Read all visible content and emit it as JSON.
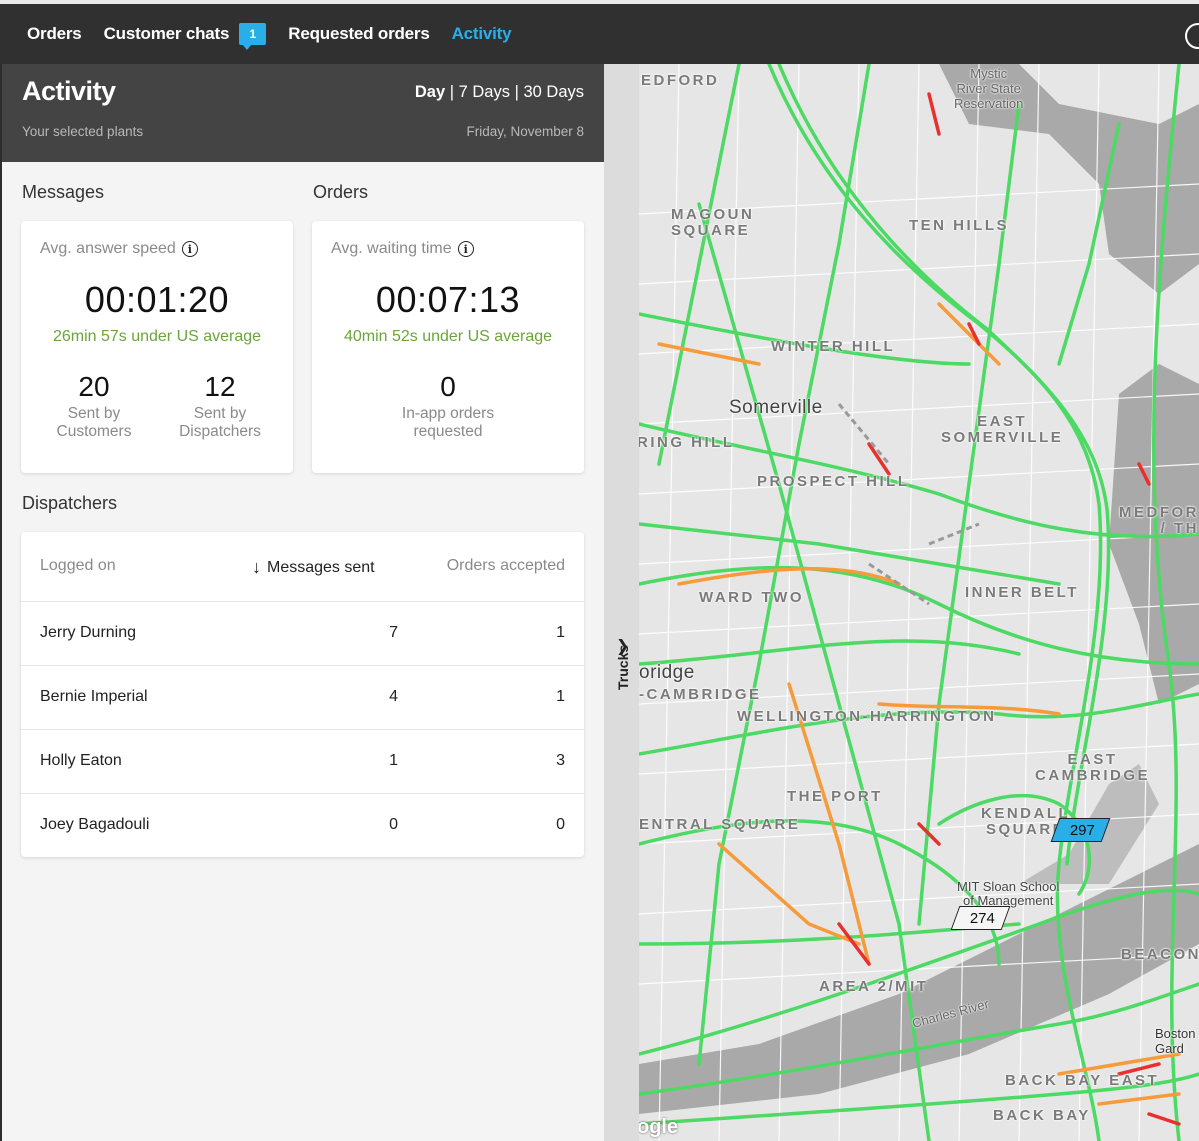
{
  "nav": {
    "items": [
      {
        "label": "Orders"
      },
      {
        "label": "Customer chats",
        "badge": "1"
      },
      {
        "label": "Requested orders"
      },
      {
        "label": "Activity"
      }
    ],
    "active_index": 3,
    "accent": "#2aaee8"
  },
  "activity": {
    "title": "Activity",
    "subtitle": "Your selected plants",
    "ranges": [
      "Day",
      "7 Days",
      "30 Days"
    ],
    "range_separator": "|",
    "selected_range": "Day",
    "date": "Friday, November 8"
  },
  "messages": {
    "section_title": "Messages",
    "metric_label": "Avg. answer speed",
    "metric_value": "00:01:20",
    "comparison": "26min 57s under US average",
    "stats": [
      {
        "value": "20",
        "label_line1": "Sent by",
        "label_line2": "Customers"
      },
      {
        "value": "12",
        "label_line1": "Sent by",
        "label_line2": "Dispatchers"
      }
    ]
  },
  "orders": {
    "section_title": "Orders",
    "metric_label": "Avg. waiting time",
    "metric_value": "00:07:13",
    "comparison": "40min 52s under US average",
    "stat": {
      "value": "0",
      "label_line1": "In-app orders",
      "label_line2": "requested"
    }
  },
  "dispatchers": {
    "section_title": "Dispatchers",
    "columns": [
      "Logged on",
      "Messages sent",
      "Orders accepted"
    ],
    "sorted_column": "Messages sent",
    "rows": [
      {
        "name": "Jerry Durning",
        "messages": "7",
        "orders": "1"
      },
      {
        "name": "Bernie Imperial",
        "messages": "4",
        "orders": "1"
      },
      {
        "name": "Holly Eaton",
        "messages": "1",
        "orders": "3"
      },
      {
        "name": "Joey Bagadouli",
        "messages": "0",
        "orders": "0"
      }
    ]
  },
  "trucks_panel": {
    "label": "Trucks"
  },
  "map": {
    "labels": {
      "medford_top": "EDFORD",
      "mystic_reservation": "Mystic\nRiver State\nReservation",
      "magoun_square": "MAGOUN\nSQUARE",
      "ten_hills": "TEN HILLS",
      "winter_hill": "WINTER HILL",
      "somerville": "Somerville",
      "east_somerville": "EAST\nSOMERVILLE",
      "spring_hill": "RING HILL",
      "prospect_hill": "PROSPECT HILL",
      "medford_right": "MEDFOR\n/ TH",
      "ward_two": "WARD TWO",
      "inner_belt": "INNER BELT",
      "cambridge": "oridge",
      "mid_cambridge": "-CAMBRIDGE",
      "wellington_harrington": "WELLINGTON-HARRINGTON",
      "east_cambridge": "EAST\nCAMBRIDGE",
      "the_port": "THE PORT",
      "kendall_square": "KENDALL\nSQUARE",
      "central_square": "ENTRAL SQUARE",
      "mit_sloan": "MIT Sloan School\nof Management",
      "beacon": "BEACON",
      "area_2_mit": "AREA 2/MIT",
      "charles_river": "Charles River",
      "boston_garden": "Boston\nGard",
      "back_bay_east": "BACK BAY EAST",
      "back_bay": "BACK BAY",
      "google": "ogle"
    },
    "trucks": [
      {
        "id": "297",
        "status": "active",
        "color": "#2aaee8"
      },
      {
        "id": "274",
        "status": "idle",
        "color": "#f5f5f5"
      }
    ],
    "traffic_colors": {
      "fast": "#4cd964",
      "medium": "#f79a3a",
      "slow": "#e8302e"
    }
  }
}
